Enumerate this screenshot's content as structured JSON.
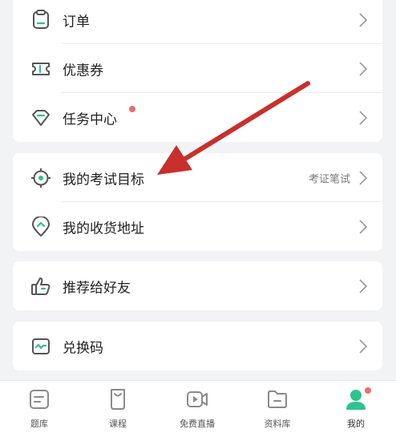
{
  "menu": {
    "group1": [
      {
        "label": "订单",
        "icon": "order-icon"
      },
      {
        "label": "优惠券",
        "icon": "coupon-icon"
      },
      {
        "label": "任务中心",
        "icon": "task-center-icon"
      }
    ],
    "group2": [
      {
        "label": "我的考试目标",
        "icon": "target-icon",
        "value": "考证笔试"
      },
      {
        "label": "我的收货地址",
        "icon": "location-icon"
      }
    ],
    "group3": [
      {
        "label": "推荐给好友",
        "icon": "thumbs-up-icon"
      }
    ],
    "group4": [
      {
        "label": "兑换码",
        "icon": "redeem-code-icon"
      }
    ]
  },
  "tabbar": {
    "items": [
      {
        "label": "题库",
        "icon": "question-bank-icon"
      },
      {
        "label": "课程",
        "icon": "course-icon"
      },
      {
        "label": "免费直播",
        "icon": "live-video-icon"
      },
      {
        "label": "资料库",
        "icon": "folder-icon"
      },
      {
        "label": "我的",
        "icon": "profile-icon",
        "active": true
      }
    ]
  },
  "colors": {
    "accent": "#2ec28e",
    "badge": "#f06b6b",
    "annotation_arrow": "#c9302c",
    "background": "#f2f3f5"
  }
}
